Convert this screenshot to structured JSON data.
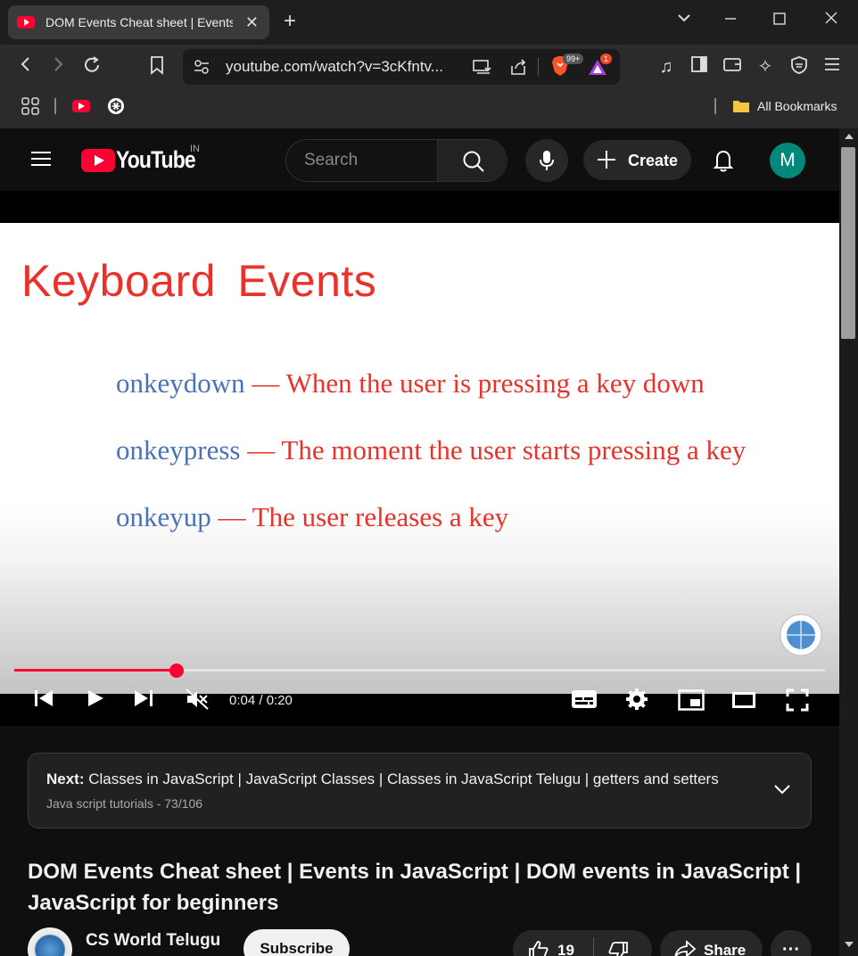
{
  "browser": {
    "tab_title": "DOM Events Cheat sheet | Events in JavaScript",
    "new_tab_icon": "plus-icon",
    "url": "youtube.com/watch?v=3cKfntv...",
    "bookmarks_label": "All Bookmarks",
    "brave_badge": "99+",
    "rewards_badge": "1"
  },
  "youtube": {
    "logo_text": "YouTube",
    "region": "IN",
    "search_placeholder": "Search",
    "create_label": "Create",
    "avatar_letter": "M"
  },
  "slide": {
    "title": "Keyboard  Events",
    "lines": [
      {
        "keyword": "onkeydown",
        "desc": " — When the user is pressing a key down"
      },
      {
        "keyword": "onkeypress",
        "desc": " — The moment the user starts pressing a key"
      },
      {
        "keyword": "onkeyup",
        "desc": " — The user releases a key"
      }
    ]
  },
  "player": {
    "time": "0:04 / 0:20",
    "progress_fraction": 0.2,
    "accent_color": "#ff0033"
  },
  "next": {
    "label": "Next:",
    "title": "Classes in JavaScript | JavaScript Classes | Classes in JavaScript Telugu | getters and setters",
    "playlist": "Java script tutorials - 73/106"
  },
  "video": {
    "title": "DOM Events Cheat sheet | Events in JavaScript | DOM events in JavaScript | JavaScript for beginners",
    "channel": "CS World Telugu",
    "subscribe_label": "Subscribe",
    "likes": "19",
    "share_label": "Share"
  }
}
